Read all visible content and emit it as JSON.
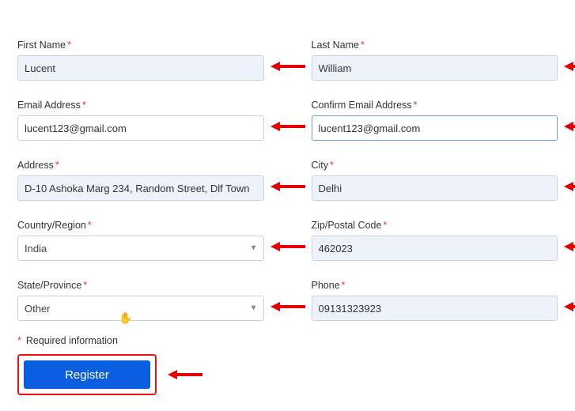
{
  "form": {
    "first_name": {
      "label": "First Name",
      "value": "Lucent"
    },
    "last_name": {
      "label": "Last Name",
      "value": "William"
    },
    "email": {
      "label": "Email Address",
      "value": "lucent123@gmail.com"
    },
    "confirm_email": {
      "label": "Confirm Email Address",
      "value": "lucent123@gmail.com"
    },
    "address": {
      "label": "Address",
      "value": "D-10 Ashoka Marg 234, Random Street, Dlf Town"
    },
    "city": {
      "label": "City",
      "value": "Delhi"
    },
    "country": {
      "label": "Country/Region",
      "value": "India"
    },
    "zip": {
      "label": "Zip/Postal Code",
      "value": "462023"
    },
    "state": {
      "label": "State/Province",
      "value": "Other"
    },
    "phone": {
      "label": "Phone",
      "value": "09131323923"
    }
  },
  "required_note": "Required information",
  "register_label": "Register",
  "asterisk": "*"
}
